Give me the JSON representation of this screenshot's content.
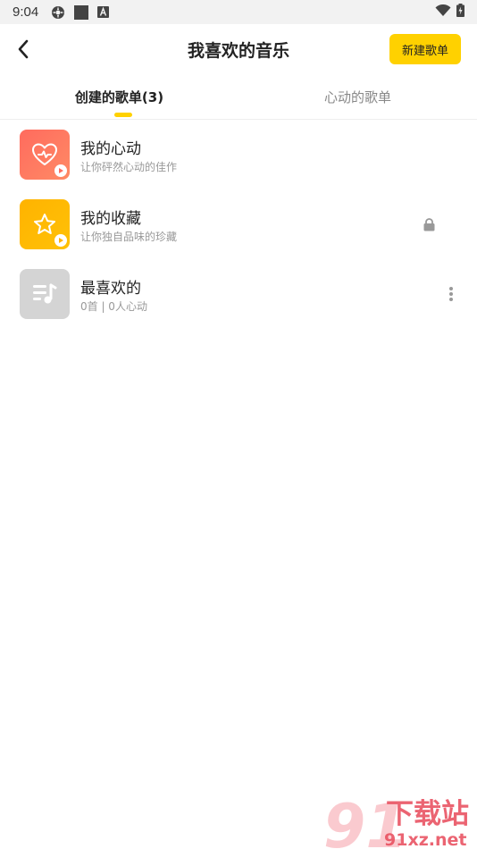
{
  "status_bar": {
    "time": "9:04",
    "icons": [
      "settings-icon",
      "square-icon",
      "a-icon",
      "wifi-icon",
      "battery-icon"
    ]
  },
  "header": {
    "title": "我喜欢的音乐",
    "new_button_label": "新建歌单",
    "back_icon": "chevron-left-icon"
  },
  "tabs": [
    {
      "label": "创建的歌单(3)",
      "active": true
    },
    {
      "label": "心动的歌单",
      "active": false
    }
  ],
  "playlists": [
    {
      "title": "我的心动",
      "subtitle": "让你砰然心动的佳作",
      "cover": "heart-pulse-icon",
      "color": "#ff6b5e",
      "trailing": ""
    },
    {
      "title": "我的收藏",
      "subtitle": "让你独自品味的珍藏",
      "cover": "star-icon",
      "color": "#ffb300",
      "trailing": "lock-icon"
    },
    {
      "title": "最喜欢的",
      "subtitle": "0首 | 0人心动",
      "cover": "music-list-icon",
      "color": "#d4d4d4",
      "trailing": "more-vertical-icon"
    }
  ],
  "watermark": {
    "logo": "91",
    "text1": "下载站",
    "text2": "91xz.net"
  },
  "colors": {
    "accent": "#ffd100",
    "text_primary": "#222222",
    "text_secondary": "#999999"
  }
}
